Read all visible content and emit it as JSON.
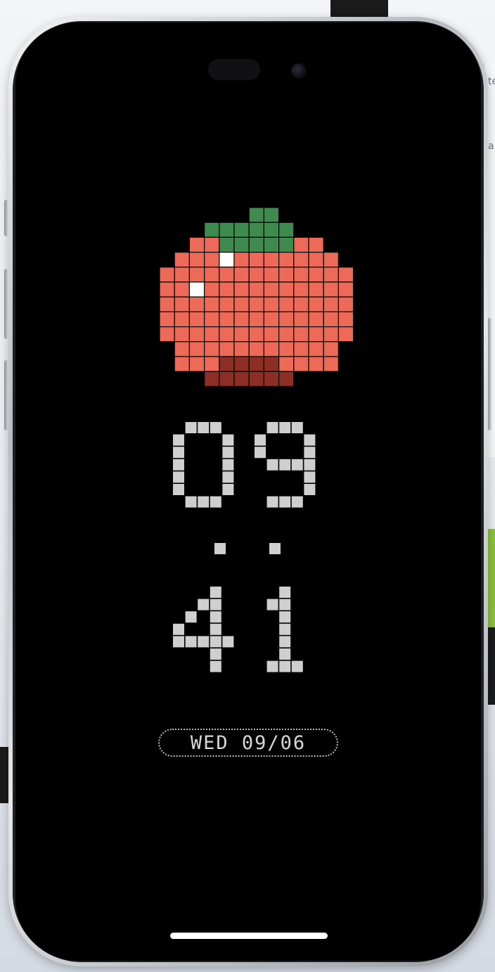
{
  "lock_screen": {
    "time": {
      "hour": "09",
      "minute": "41"
    },
    "date": "WED 09/06"
  },
  "background_fragments": [
    "te",
    "a"
  ],
  "icons": {
    "tomato": "tomato-pixel-art-icon",
    "camera": "front-camera-icon"
  },
  "colors": {
    "tomato_body": "#ec6a57",
    "tomato_shadow": "#8c2e24",
    "tomato_leaf": "#3f8a4e",
    "tomato_highlight": "#ffffff",
    "clock_pixels": "#cfcfcf",
    "screen_background": "#000000"
  }
}
